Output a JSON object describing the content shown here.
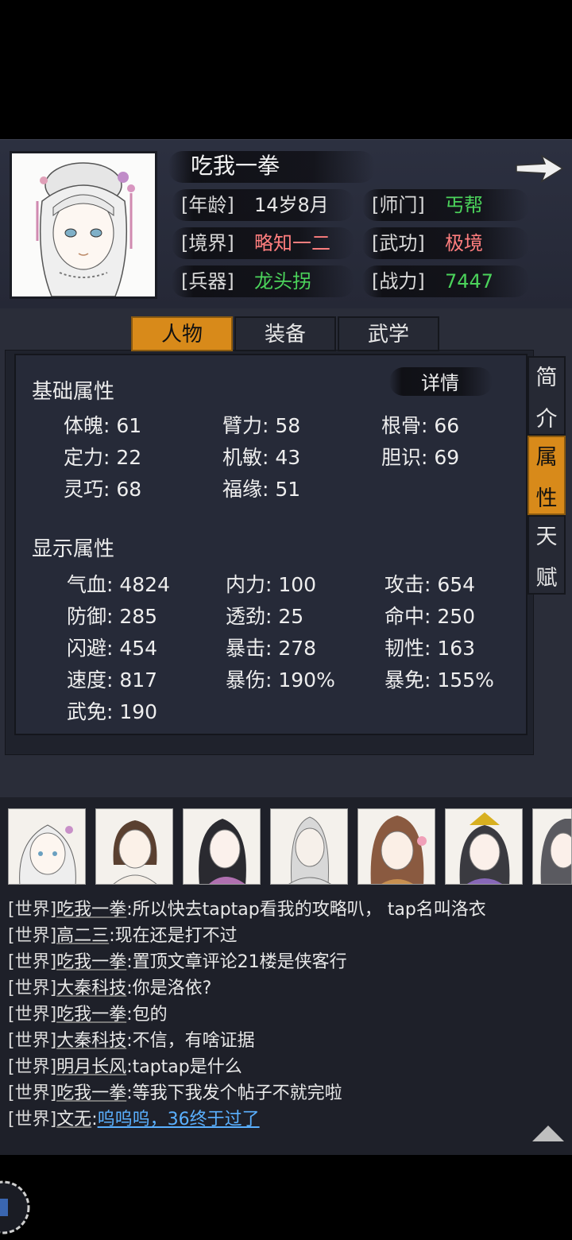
{
  "character": {
    "name": "吃我一拳",
    "age_label": "[年龄]",
    "age": "14岁8月",
    "sect_label": "[师门]",
    "sect": "丐帮",
    "realm_label": "[境界]",
    "realm": "略知一二",
    "martial_label": "[武功]",
    "martial": "极境",
    "weapon_label": "[兵器]",
    "weapon": "龙头拐",
    "power_label": "[战力]",
    "power": "7447"
  },
  "tabs": [
    "人物",
    "装备",
    "武学"
  ],
  "side_tabs": [
    {
      "chars": [
        "简",
        "介"
      ]
    },
    {
      "chars": [
        "属",
        "性"
      ]
    },
    {
      "chars": [
        "天",
        "赋"
      ]
    }
  ],
  "detail_label": "详情",
  "basic": {
    "title": "基础属性",
    "stats": [
      "体魄: 61",
      "臂力: 58",
      "根骨: 66",
      "定力: 22",
      "机敏: 43",
      "胆识: 69",
      "灵巧: 68",
      "福缘: 51"
    ]
  },
  "display": {
    "title": "显示属性",
    "stats": [
      "气血: 4824",
      "内力: 100",
      "攻击: 654",
      "防御: 285",
      "透劲: 25",
      "命中: 250",
      "闪避: 454",
      "暴击: 278",
      "韧性: 163",
      "速度: 817",
      "暴伤: 190%",
      "暴免: 155%",
      "武免: 190"
    ]
  },
  "chat": [
    {
      "channel": "[世界]",
      "user": "吃我一拳",
      "msg": ":所以快去taptap看我的攻略叭， tap名叫洛衣"
    },
    {
      "channel": "[世界]",
      "user": "高二三",
      "msg": ":现在还是打不过"
    },
    {
      "channel": "[世界]",
      "user": "吃我一拳",
      "msg": ":置顶文章评论21楼是侠客行"
    },
    {
      "channel": "[世界]",
      "user": "大秦科技",
      "msg": ":你是洛依?"
    },
    {
      "channel": "[世界]",
      "user": "吃我一拳",
      "msg": ":包的"
    },
    {
      "channel": "[世界]",
      "user": "大秦科技",
      "msg": ":不信，有啥证据"
    },
    {
      "channel": "[世界]",
      "user": "明月长风",
      "msg": ":taptap是什么"
    },
    {
      "channel": "[世界]",
      "user": "吃我一拳",
      "msg": ":等我下我发个帖子不就完啦"
    },
    {
      "channel": "[世界]",
      "user": "文无",
      "msg": ":",
      "link": "呜呜呜，36终于过了"
    }
  ],
  "colors": {
    "accent_orange": "#d88a1a",
    "green": "#4bd35b",
    "pink": "#ff7e7e",
    "link": "#5ab0ff"
  }
}
